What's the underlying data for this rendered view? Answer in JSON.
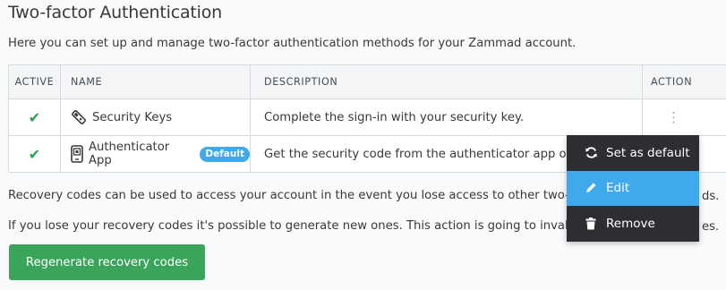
{
  "page": {
    "title": "Two-factor Authentication",
    "intro": "Here you can set up and manage two-factor authentication methods for your Zammad account."
  },
  "table": {
    "headers": [
      "ACTIVE",
      "NAME",
      "DESCRIPTION",
      "ACTION"
    ],
    "rows": [
      {
        "active_icon": "check-icon",
        "icon": "security-key-icon",
        "name": "Security Keys",
        "badge": "",
        "description": "Complete the sign-in with your security key."
      },
      {
        "active_icon": "check-icon",
        "icon": "authenticator-app-icon",
        "name": "Authenticator App",
        "badge": "Default",
        "description": "Get the security code from the authenticator app on y"
      }
    ]
  },
  "paragraphs": [
    "Recovery codes can be used to access your account in the event you lose access to other two-facto",
    "If you lose your recovery codes it's possible to generate new ones. This action is going to invalidat"
  ],
  "paragraph_tails": [
    "ds.",
    "es."
  ],
  "button": {
    "label": "Regenerate recovery codes"
  },
  "context_menu": {
    "items": [
      {
        "label": "Set as default",
        "icon": "refresh-icon"
      },
      {
        "label": "Edit",
        "icon": "pencil-icon",
        "active": true
      },
      {
        "label": "Remove",
        "icon": "trash-icon"
      }
    ]
  },
  "colors": {
    "success": "#2aa14a",
    "accent": "#3ea9ed",
    "button": "#3aa45b",
    "menu_bg": "#2c2e31"
  }
}
